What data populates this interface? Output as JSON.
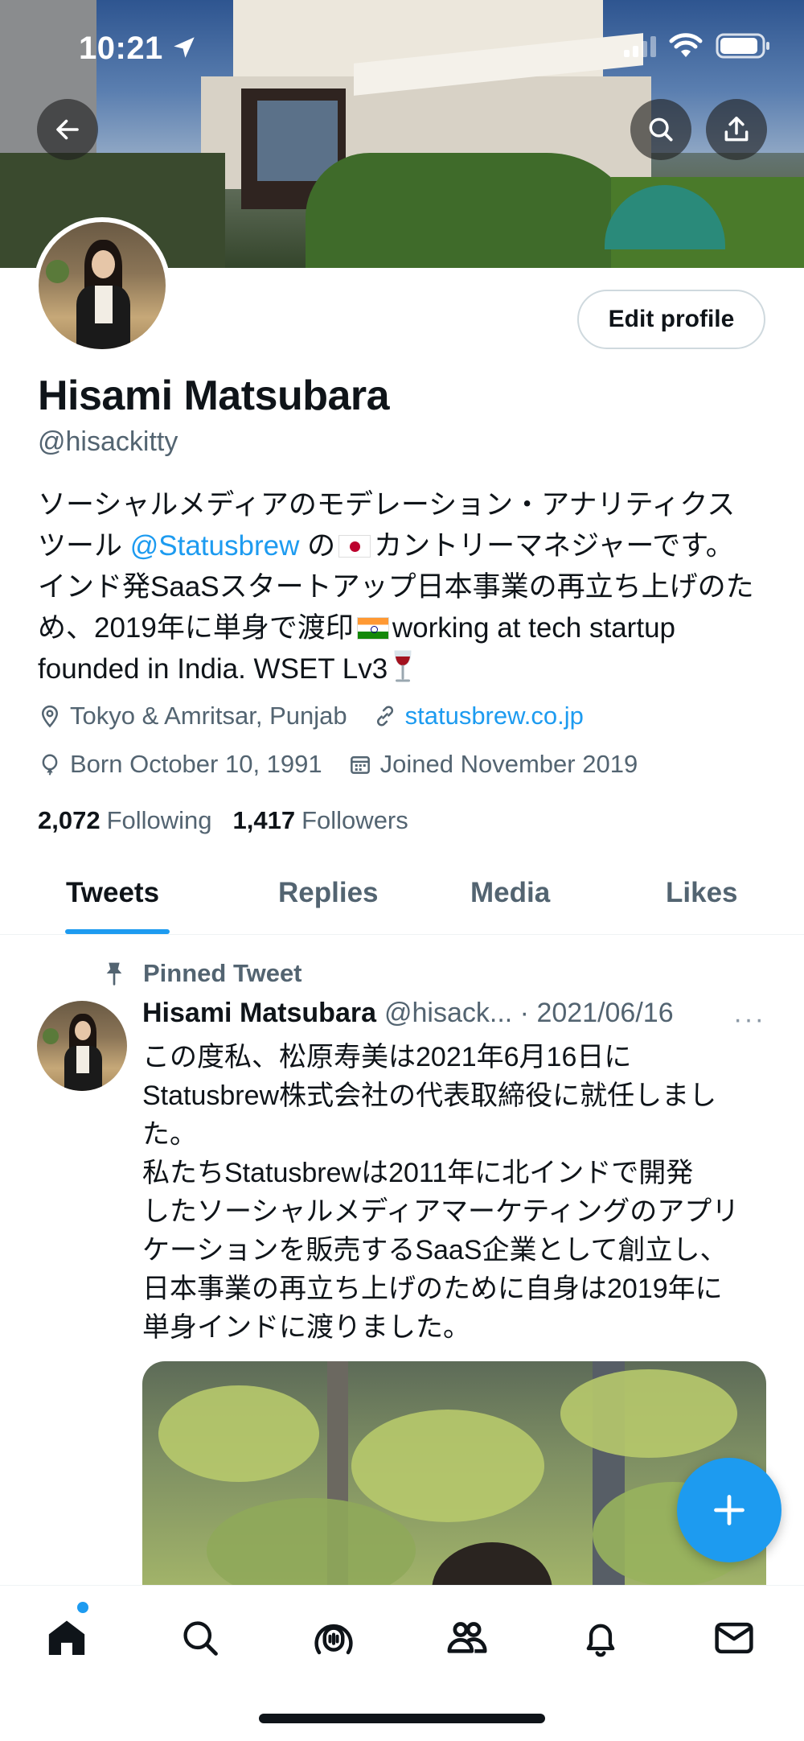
{
  "status_bar": {
    "time": "10:21"
  },
  "header": {
    "back_icon": "arrow-left-icon",
    "search_icon": "search-icon",
    "share_icon": "share-icon"
  },
  "profile": {
    "edit_label": "Edit profile",
    "display_name": "Hisami Matsubara",
    "handle": "@hisackitty",
    "bio": {
      "line1": "ソーシャルメディアのモデレーション・アナリティクス",
      "line2_a": "ツール ",
      "line2_link": "@Statusbrew",
      "line2_b": " の",
      "line2_c": "カントリーマネジャーです。",
      "line3": "インド発SaaSスタートアップ日本事業の再立ち上げのた",
      "line4_a": "め、2019年に単身で渡印",
      "line4_b": "working at tech startup",
      "line5": "founded in India. WSET Lv3"
    },
    "location": "Tokyo & Amritsar, Punjab",
    "website": "statusbrew.co.jp",
    "birthday": "Born October 10, 1991",
    "joined": "Joined November 2019",
    "following_count": "2,072",
    "following_label": "Following",
    "followers_count": "1,417",
    "followers_label": "Followers"
  },
  "tabs": [
    {
      "label": "Tweets",
      "active": true
    },
    {
      "label": "Replies",
      "active": false
    },
    {
      "label": "Media",
      "active": false
    },
    {
      "label": "Likes",
      "active": false
    }
  ],
  "pinned_tweet": {
    "pinned_label": "Pinned Tweet",
    "author_name": "Hisami Matsubara",
    "author_meta": "@hisack... · 2021/06/16",
    "more": "···",
    "text_lines": [
      "この度私、松原寿美は2021年6月16日に",
      "Statusbrew株式会社の代表取締役に就任しまし",
      "た。",
      "私たちStatusbrewは2011年に北インドで開発",
      "したソーシャルメディアマーケティングのアプリ",
      "ケーションを販売するSaaS企業として創立し、",
      "日本事業の再立ち上げのために自身は2019年に",
      "単身インドに渡りました。"
    ]
  },
  "compose_button": {
    "icon": "plus-icon"
  },
  "bottom_nav": [
    {
      "icon": "home-icon",
      "active": true
    },
    {
      "icon": "search-icon"
    },
    {
      "icon": "spaces-icon"
    },
    {
      "icon": "communities-icon"
    },
    {
      "icon": "notifications-icon"
    },
    {
      "icon": "messages-icon"
    }
  ],
  "colors": {
    "accent": "#1d9bf0",
    "text_primary": "#0f1419",
    "text_secondary": "#536471"
  }
}
